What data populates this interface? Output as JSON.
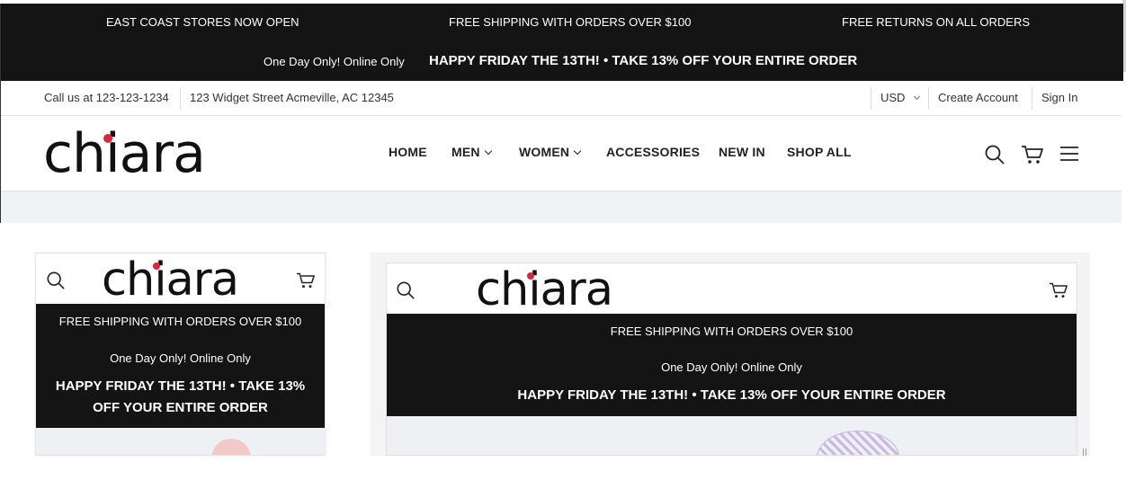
{
  "promo": {
    "left": "EAST COAST STORES NOW OPEN",
    "center": "FREE SHIPPING WITH ORDERS OVER $100",
    "right": "FREE RETURNS ON ALL ORDERS",
    "one_day": "One Day Only! Online Only",
    "headline": "HAPPY FRIDAY THE 13TH! • TAKE 13% OFF YOUR ENTIRE ORDER"
  },
  "utility": {
    "phone": "Call us at 123-123-1234",
    "address": "123 Widget Street Acmeville, AC 12345",
    "currency": "USD",
    "create_account": "Create Account",
    "sign_in": "Sign In"
  },
  "brand": {
    "name": "chiara",
    "dot_color": "#d7263d"
  },
  "nav": {
    "home": "HOME",
    "men": "MEN",
    "women": "WOMEN",
    "accessories": "ACCESSORIES",
    "new_in": "NEW IN",
    "shop_all": "SHOP ALL"
  },
  "icons": [
    "search-icon",
    "cart-icon",
    "menu-icon",
    "chevron-down-icon"
  ],
  "preview_small": {
    "shipping": "FREE SHIPPING WITH ORDERS OVER $100",
    "one_day": "One Day Only! Online Only",
    "headline_1": "HAPPY FRIDAY THE 13TH! • TAKE 13%",
    "headline_2": "OFF YOUR ENTIRE ORDER"
  },
  "preview_large": {
    "shipping": "FREE SHIPPING WITH ORDERS OVER $100",
    "one_day": "One Day Only! Online Only",
    "headline": "HAPPY FRIDAY THE 13TH! • TAKE 13% OFF YOUR ENTIRE ORDER"
  },
  "colors": {
    "bar": "#141414",
    "accent": "#d7263d",
    "band": "#f0f2f5"
  }
}
